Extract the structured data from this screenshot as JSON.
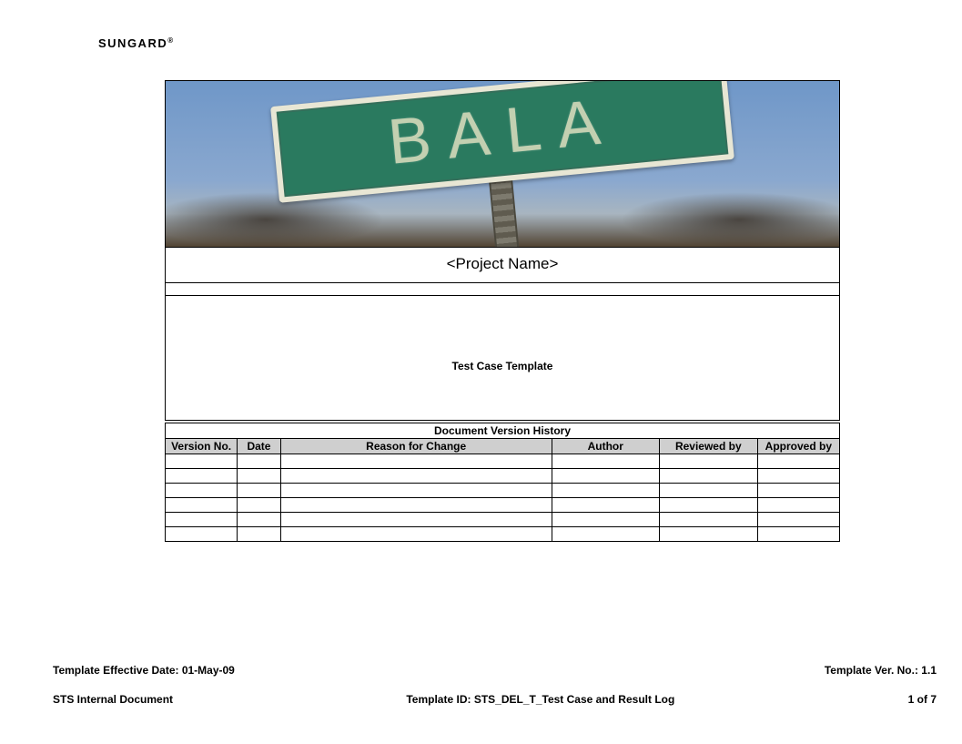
{
  "header": {
    "logo_text": "SUNGARD",
    "logo_reg": "®"
  },
  "banner": {
    "sign_text": "BALA"
  },
  "project": {
    "name": "<Project Name>",
    "subtitle": "Test Case Template"
  },
  "history": {
    "title": "Document Version History",
    "columns": [
      "Version No.",
      "Date",
      "Reason for Change",
      "Author",
      "Reviewed by",
      "Approved by"
    ],
    "rows": [
      [
        "",
        "",
        "",
        "",
        "",
        ""
      ],
      [
        "",
        "",
        "",
        "",
        "",
        ""
      ],
      [
        "",
        "",
        "",
        "",
        "",
        ""
      ],
      [
        "",
        "",
        "",
        "",
        "",
        ""
      ],
      [
        "",
        "",
        "",
        "",
        "",
        ""
      ],
      [
        "",
        "",
        "",
        "",
        "",
        ""
      ]
    ]
  },
  "footer": {
    "effective_date_label": "Template Effective Date: 01-May-09",
    "version_label": "Template Ver. No.: 1.1",
    "doc_class": "STS Internal Document",
    "template_id": "Template ID: STS_DEL_T_Test Case and Result Log",
    "page": "1 of 7"
  }
}
